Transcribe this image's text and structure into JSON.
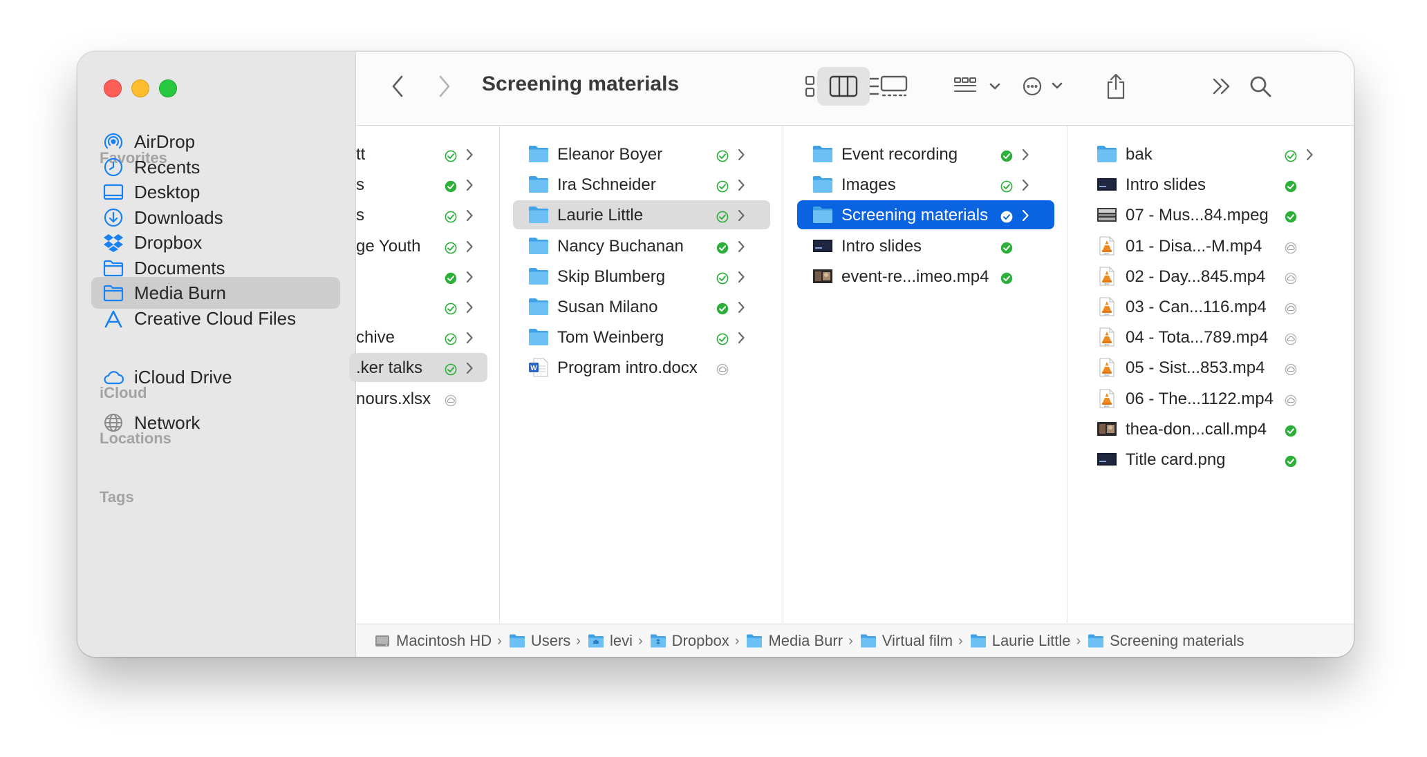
{
  "window": {
    "title": "Screening materials"
  },
  "colors": {
    "accent": "#0a63e0",
    "sync_green": "#2cb03a",
    "folder_blue": "#5ab4ee"
  },
  "sidebar": {
    "favorites_label": "Favorites",
    "favorites": [
      {
        "label": "AirDrop",
        "icon": "airdrop-icon"
      },
      {
        "label": "Recents",
        "icon": "clock-icon"
      },
      {
        "label": "Desktop",
        "icon": "desktop-icon"
      },
      {
        "label": "Downloads",
        "icon": "download-icon"
      },
      {
        "label": "Dropbox",
        "icon": "dropbox-icon"
      },
      {
        "label": "Documents",
        "icon": "folder-icon"
      },
      {
        "label": "Media Burn",
        "icon": "folder-icon",
        "selected": true
      },
      {
        "label": "Creative Cloud Files",
        "icon": "creative-cloud-icon"
      }
    ],
    "icloud_label": "iCloud",
    "icloud": [
      {
        "label": "iCloud Drive",
        "icon": "cloud-icon"
      }
    ],
    "locations_label": "Locations",
    "locations": [
      {
        "label": "Network",
        "icon": "globe-icon"
      }
    ],
    "tags_label": "Tags"
  },
  "columns": [
    {
      "name": "column-1",
      "items": [
        {
          "label": "tt",
          "sync": "outline",
          "chevron": true
        },
        {
          "label": "s",
          "sync": "solid",
          "chevron": true
        },
        {
          "label": "s",
          "sync": "outline",
          "chevron": true
        },
        {
          "label": "ge Youth",
          "sync": "outline",
          "chevron": true
        },
        {
          "label": "",
          "sync": "solid",
          "chevron": true
        },
        {
          "label": "",
          "sync": "outline",
          "chevron": true
        },
        {
          "label": "chive",
          "sync": "outline",
          "chevron": true
        },
        {
          "label": ".ker talks",
          "sync": "outline",
          "chevron": true,
          "highlight": "grey"
        },
        {
          "label": "nours.xlsx",
          "sync": "cloud",
          "chevron": false
        }
      ]
    },
    {
      "name": "column-2",
      "items": [
        {
          "label": "Eleanor Boyer",
          "icon": "folder",
          "sync": "outline",
          "chevron": true
        },
        {
          "label": "Ira Schneider",
          "icon": "folder",
          "sync": "outline",
          "chevron": true
        },
        {
          "label": "Laurie Little",
          "icon": "folder",
          "sync": "outline",
          "chevron": true,
          "highlight": "grey"
        },
        {
          "label": "Nancy Buchanan",
          "icon": "folder",
          "sync": "solid",
          "chevron": true
        },
        {
          "label": "Skip Blumberg",
          "icon": "folder",
          "sync": "outline",
          "chevron": true
        },
        {
          "label": "Susan Milano",
          "icon": "folder",
          "sync": "solid",
          "chevron": true
        },
        {
          "label": "Tom Weinberg",
          "icon": "folder",
          "sync": "outline",
          "chevron": true
        },
        {
          "label": "Program intro.docx",
          "icon": "word",
          "sync": "cloud",
          "chevron": false
        }
      ]
    },
    {
      "name": "column-3",
      "items": [
        {
          "label": "Event recording",
          "icon": "folder",
          "sync": "solid",
          "chevron": true
        },
        {
          "label": "Images",
          "icon": "folder",
          "sync": "outline",
          "chevron": true
        },
        {
          "label": "Screening materials",
          "icon": "folder",
          "sync": "outline",
          "chevron": true,
          "highlight": "blue"
        },
        {
          "label": "Intro slides",
          "icon": "slide",
          "sync": "solid",
          "chevron": false
        },
        {
          "label": "event-re...imeo.mp4",
          "icon": "video",
          "sync": "solid",
          "chevron": false
        }
      ]
    },
    {
      "name": "column-4",
      "items": [
        {
          "label": "bak",
          "icon": "folder",
          "sync": "outline",
          "chevron": true
        },
        {
          "label": "Intro slides",
          "icon": "slide",
          "sync": "solid",
          "chevron": false
        },
        {
          "label": "07 - Mus...84.mpeg",
          "icon": "mpeg",
          "sync": "solid",
          "chevron": false
        },
        {
          "label": "01 - Disa...-M.mp4",
          "icon": "m4v",
          "sync": "cloud",
          "chevron": false
        },
        {
          "label": "02 - Day...845.mp4",
          "icon": "m4v",
          "sync": "cloud",
          "chevron": false
        },
        {
          "label": "03 - Can...116.mp4",
          "icon": "m4v",
          "sync": "cloud",
          "chevron": false
        },
        {
          "label": "04 - Tota...789.mp4",
          "icon": "m4v",
          "sync": "cloud",
          "chevron": false
        },
        {
          "label": "05 - Sist...853.mp4",
          "icon": "m4v",
          "sync": "cloud",
          "chevron": false
        },
        {
          "label": "06 - The...1122.mp4",
          "icon": "m4v",
          "sync": "cloud",
          "chevron": false
        },
        {
          "label": "thea-don...call.mp4",
          "icon": "video",
          "sync": "solid",
          "chevron": false
        },
        {
          "label": "Title card.png",
          "icon": "slide",
          "sync": "solid",
          "chevron": false
        }
      ]
    }
  ],
  "pathbar": [
    {
      "label": "Macintosh HD",
      "icon": "hard-drive-icon"
    },
    {
      "label": "Users",
      "icon": "folder-icon"
    },
    {
      "label": "levi",
      "icon": "home-folder-icon"
    },
    {
      "label": "Dropbox",
      "icon": "dropbox-folder-icon"
    },
    {
      "label": "Media Burr",
      "icon": "folder-icon"
    },
    {
      "label": "Virtual film",
      "icon": "folder-icon"
    },
    {
      "label": "Laurie Little",
      "icon": "folder-icon"
    },
    {
      "label": "Screening materials",
      "icon": "folder-icon"
    }
  ]
}
